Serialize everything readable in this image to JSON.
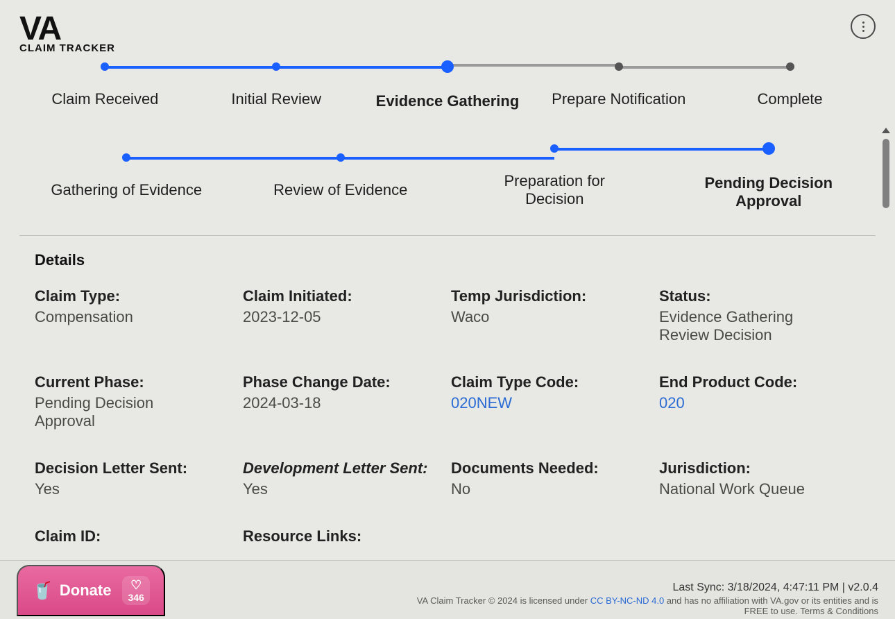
{
  "app": {
    "logo_top": "VA",
    "logo_sub": "CLAIM TRACKER"
  },
  "progress1": {
    "steps": [
      {
        "label": "Claim Received",
        "state": "done"
      },
      {
        "label": "Initial Review",
        "state": "done"
      },
      {
        "label": "Evidence Gathering",
        "state": "current"
      },
      {
        "label": "Prepare Notification",
        "state": "future"
      },
      {
        "label": "Complete",
        "state": "future"
      }
    ]
  },
  "progress2": {
    "steps": [
      {
        "label": "Gathering of Evidence",
        "state": "done"
      },
      {
        "label": "Review of Evidence",
        "state": "done"
      },
      {
        "label": "Preparation for Decision",
        "state": "done"
      },
      {
        "label": "Pending Decision Approval",
        "state": "current"
      }
    ]
  },
  "details": {
    "title": "Details",
    "fields": [
      {
        "label": "Claim Type:",
        "value": "Compensation"
      },
      {
        "label": "Claim Initiated:",
        "value": "2023-12-05"
      },
      {
        "label": "Temp Jurisdiction:",
        "value": "Waco"
      },
      {
        "label": "Status:",
        "value": "Evidence Gathering Review Decision"
      },
      {
        "label": "Current Phase:",
        "value": "Pending Decision Approval"
      },
      {
        "label": "Phase Change Date:",
        "value": "2024-03-18"
      },
      {
        "label": "Claim Type Code:",
        "value": "020NEW",
        "link": true
      },
      {
        "label": "End Product Code:",
        "value": "020",
        "link": true
      },
      {
        "label": "Decision Letter Sent:",
        "value": "Yes"
      },
      {
        "label": "Development Letter Sent:",
        "value": "Yes",
        "italic": true
      },
      {
        "label": "Documents Needed:",
        "value": "No"
      },
      {
        "label": "Jurisdiction:",
        "value": "National Work Queue"
      },
      {
        "label": "Claim ID:",
        "value": ""
      },
      {
        "label": "Resource Links:",
        "value": ""
      }
    ]
  },
  "donate": {
    "label": "Donate",
    "count": "346"
  },
  "footer": {
    "sync": "Last Sync: 3/18/2024, 4:47:11 PM | v2.0.4",
    "license_pre": "VA Claim Tracker © 2024 is licensed under ",
    "license_link": "CC BY-NC-ND 4.0",
    "license_post": " and has no affiliation with VA.gov or its entities and is FREE to use. Terms & Conditions"
  }
}
